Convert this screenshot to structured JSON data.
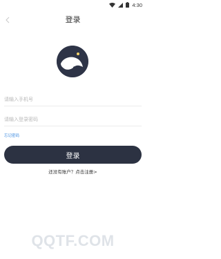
{
  "status_bar": {
    "time": "4:30",
    "icons": [
      "wifi-icon",
      "signal-icon",
      "battery-icon"
    ]
  },
  "header": {
    "title": "登录",
    "back_icon": "chevron-left-icon"
  },
  "logo": {
    "icon": "moon-whale-logo",
    "bg_color": "#2e3447"
  },
  "form": {
    "phone_placeholder": "请输入手机号",
    "phone_value": "",
    "password_placeholder": "请输入登录密码",
    "password_value": "",
    "forgot_label": "忘记密码",
    "login_label": "登录",
    "register_text": "还没有账户？点击注册>"
  },
  "colors": {
    "accent": "#2c3242",
    "link": "#3d8be0"
  },
  "watermark": "QQTF.COM"
}
